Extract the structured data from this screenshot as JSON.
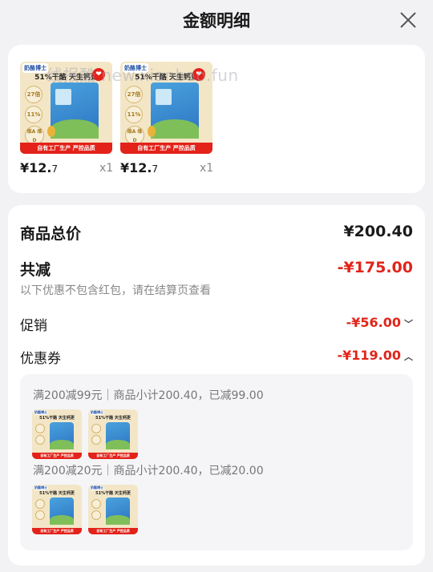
{
  "header": {
    "title": "金额明细",
    "close_icon": "close-icon"
  },
  "watermark": "线报酷 new.xianbao.fun",
  "product": {
    "brand": "奶酪博士",
    "topline": "51%干酪 天生钙更",
    "badge": "27倍",
    "badge2": "11%",
    "vit": "维A 维D",
    "banner": "自有工厂生产 严控品质",
    "heart": "❤"
  },
  "items": [
    {
      "price_int": "¥12.",
      "price_dec": "7",
      "qty": "x1"
    },
    {
      "price_int": "¥12.",
      "price_dec": "7",
      "qty": "x1"
    }
  ],
  "summary": {
    "total_label": "商品总价",
    "total_value": "¥200.40",
    "discount_label": "共减",
    "discount_value": "-¥175.00",
    "discount_hint": "以下优惠不包含红包，请在结算页查看",
    "promo_label": "促销",
    "promo_value": "-¥56.00",
    "coupon_label": "优惠券",
    "coupon_value": "-¥119.00"
  },
  "coupons": [
    {
      "text": "满200减99元｜商品小计200.40，已减99.00"
    },
    {
      "text": "满200减20元｜商品小计200.40，已减20.00"
    }
  ],
  "colors": {
    "accent": "#e1251b",
    "background": "#f2f2f4",
    "card": "#ffffff"
  }
}
